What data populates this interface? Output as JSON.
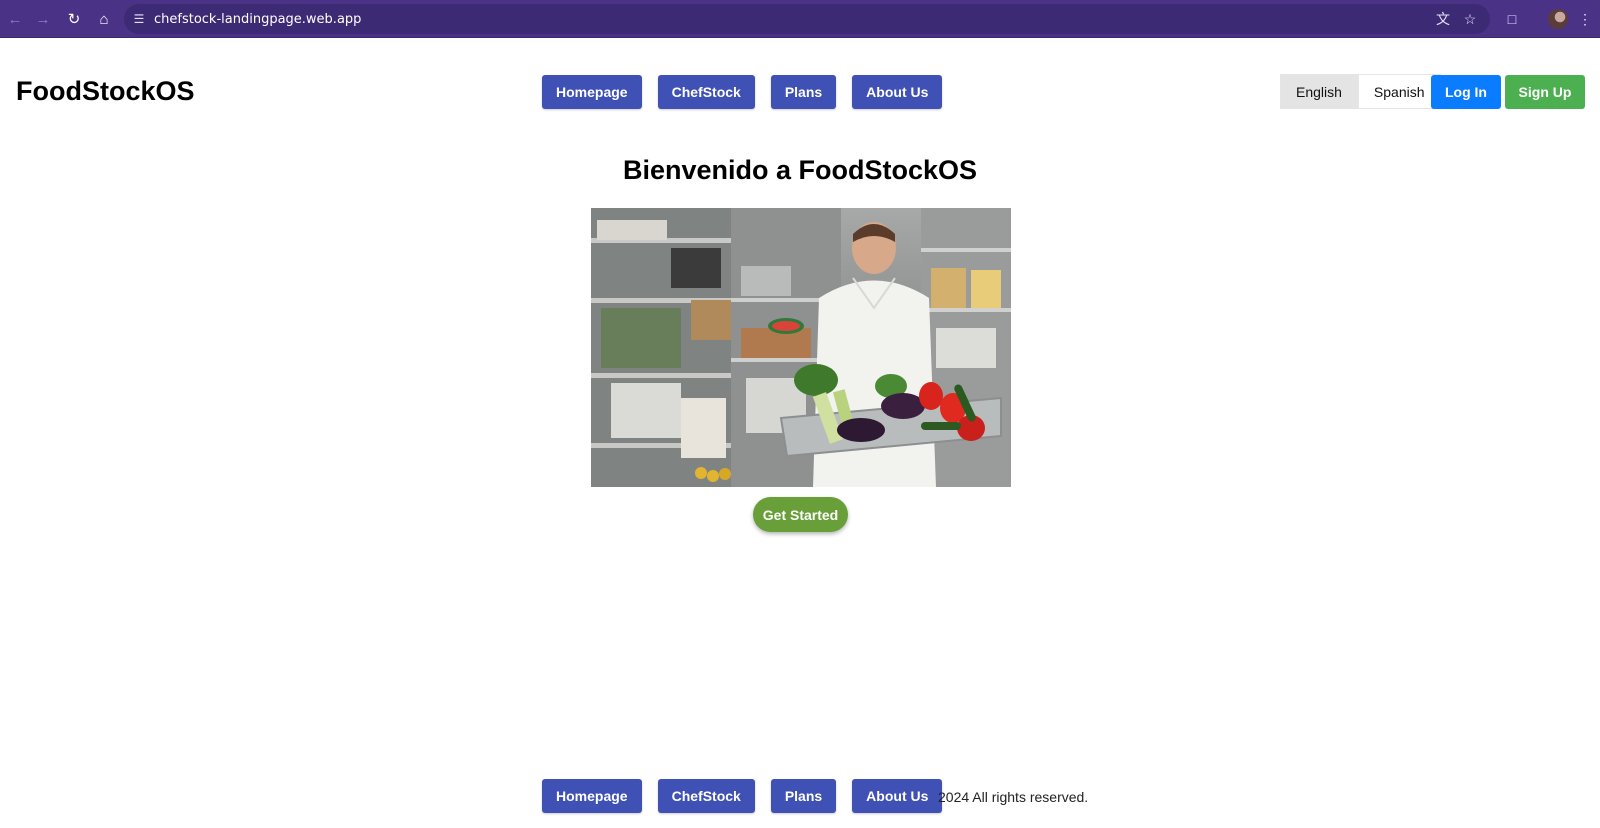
{
  "browser": {
    "url": "chefstock-landingpage.web.app"
  },
  "header": {
    "brand": "FoodStockOS",
    "nav": [
      "Homepage",
      "ChefStock",
      "Plans",
      "About Us"
    ],
    "languages": {
      "english": "English",
      "spanish": "Spanish",
      "selected": "English"
    },
    "login_label": "Log In",
    "signup_label": "Sign Up"
  },
  "hero": {
    "title": "Bienvenido a FoodStockOS",
    "cta_label": "Get Started"
  },
  "footer": {
    "nav": [
      "Homepage",
      "ChefStock",
      "Plans",
      "About Us"
    ],
    "copyright": "2024 All rights reserved."
  },
  "colors": {
    "browser_bar": "#4a3287",
    "nav_button": "#3f51b5",
    "login_button": "#0a7cff",
    "signup_button": "#4caf50",
    "cta_button": "#689f38"
  }
}
